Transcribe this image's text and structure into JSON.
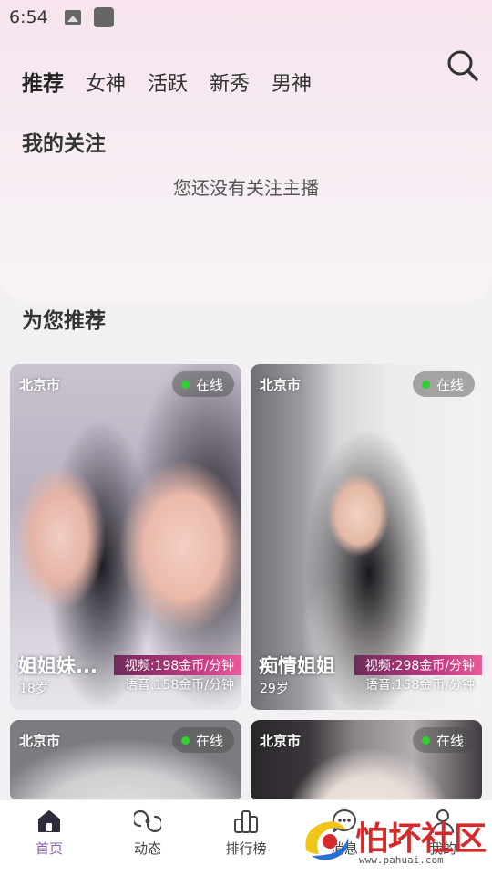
{
  "status_bar": {
    "time": "6:54"
  },
  "tabs": [
    {
      "label": "推荐",
      "active": true
    },
    {
      "label": "女神",
      "active": false
    },
    {
      "label": "活跃",
      "active": false
    },
    {
      "label": "新秀",
      "active": false
    },
    {
      "label": "男神",
      "active": false
    }
  ],
  "following": {
    "title": "我的关注",
    "empty_text": "您还没有关注主播"
  },
  "recommend": {
    "title": "为您推荐"
  },
  "cards": [
    {
      "city": "北京市",
      "online": "在线",
      "name": "姐姐妹...",
      "age": "18岁",
      "video_price": "视频:198金币/分钟",
      "voice_price": "语音:158金币/分钟"
    },
    {
      "city": "北京市",
      "online": "在线",
      "name": "痴情姐姐",
      "age": "29岁",
      "video_price": "视频:298金币/分钟",
      "voice_price": "语音:158金币/分钟"
    },
    {
      "city": "北京市",
      "online": "在线"
    },
    {
      "city": "北京市",
      "online": "在线"
    }
  ],
  "bottom_nav": [
    {
      "label": "首页",
      "icon": "home-icon",
      "active": true
    },
    {
      "label": "动态",
      "icon": "moments-icon",
      "active": false
    },
    {
      "label": "排行榜",
      "icon": "ranking-icon",
      "active": false
    },
    {
      "label": "消息",
      "icon": "message-icon",
      "active": false
    },
    {
      "label": "我的",
      "icon": "profile-icon",
      "active": false
    }
  ],
  "watermark": {
    "text": "怕坏社区",
    "url": "www.pahuai.com"
  },
  "colors": {
    "accent": "#8a5fb0",
    "online_dot": "#2ed12e",
    "price_tag": "#c83d84"
  }
}
